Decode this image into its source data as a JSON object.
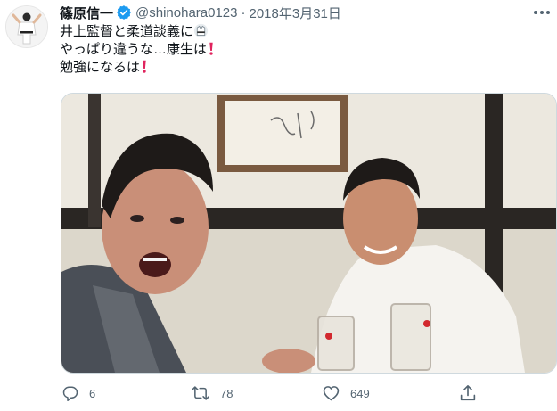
{
  "tweet": {
    "author_name": "篠原信一",
    "handle": "@shinohara0123",
    "separator": "·",
    "date": "2018年3月31日",
    "lines": [
      {
        "text": "井上監督と柔道談義に",
        "emoji": "judo-uniform-icon"
      },
      {
        "text": "やっぱり違うな…康生は",
        "emoji": "exclamation-icon"
      },
      {
        "text": "勉強になるは",
        "emoji": "exclamation-icon"
      }
    ]
  },
  "actions": {
    "reply_count": "6",
    "retweet_count": "78",
    "like_count": "649"
  },
  "colors": {
    "verified": "#1d9bf0",
    "exclamation": "#e0245e",
    "muted": "#536471",
    "text": "#0f1419"
  },
  "icons": [
    "verified-badge-icon",
    "more-icon",
    "reply-icon",
    "retweet-icon",
    "like-icon",
    "share-icon"
  ]
}
